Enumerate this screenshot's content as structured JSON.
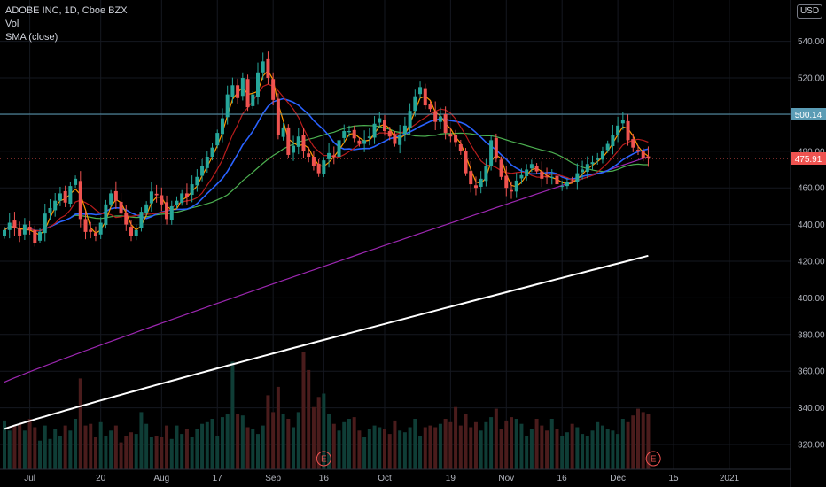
{
  "header": {
    "symbol": "ADOBE INC, 1D, Cboe BZX",
    "vol_label": "Vol",
    "sma_label": "SMA (close)",
    "currency": "USD"
  },
  "price_tags": {
    "resistance": "500.14",
    "last": "475.91"
  },
  "colors": {
    "background": "#000000",
    "up": "#26a69a",
    "down": "#ef5350",
    "sma_orange": "#ff9800",
    "sma_darkred": "#b71c1c",
    "sma_blue": "#2962ff",
    "sma_green": "#4caf50",
    "sma_purple": "#9c27b0",
    "sma_white": "#ffffff",
    "resistance_line": "#5b9cb5"
  },
  "chart_data": {
    "type": "candlestick",
    "ylim": [
      310,
      562
    ],
    "y_ticks": [
      320,
      340,
      360,
      380,
      400,
      420,
      440,
      460,
      480,
      500,
      520,
      540
    ],
    "x_labels": [
      "Jul",
      "20",
      "Aug",
      "17",
      "Sep",
      "16",
      "Oct",
      "19",
      "Nov",
      "16",
      "Dec",
      "15",
      "2021"
    ],
    "x_label_index": [
      5,
      19,
      31,
      42,
      53,
      63,
      75,
      88,
      99,
      110,
      121,
      132,
      143
    ],
    "earnings_index": [
      63,
      128
    ],
    "earnings_label": "E",
    "resistance_level": 500.14,
    "last_price": 475.91,
    "closes": [
      437,
      441,
      438,
      434,
      440,
      437,
      430,
      436,
      446,
      449,
      453,
      457,
      452,
      461,
      465,
      443,
      436,
      436,
      434,
      441,
      451,
      457,
      453,
      446,
      440,
      434,
      437,
      447,
      451,
      458,
      456,
      451,
      443,
      450,
      453,
      457,
      455,
      462,
      466,
      472,
      477,
      482,
      490,
      498,
      511,
      516,
      509,
      520,
      504,
      511,
      523,
      529,
      520,
      508,
      489,
      493,
      478,
      483,
      488,
      480,
      477,
      472,
      468,
      475,
      479,
      477,
      486,
      491,
      491,
      487,
      484,
      486,
      488,
      495,
      498,
      491,
      488,
      484,
      489,
      494,
      502,
      510,
      515,
      505,
      503,
      496,
      499,
      490,
      488,
      485,
      480,
      468,
      462,
      460,
      465,
      472,
      486,
      476,
      466,
      460,
      458,
      464,
      467,
      470,
      473,
      469,
      465,
      466,
      466,
      462,
      461,
      463,
      464,
      468,
      470,
      473,
      474,
      476,
      480,
      484,
      489,
      494,
      497,
      486,
      482,
      480,
      476,
      476
    ],
    "volumes_m": [
      2.9,
      2.3,
      2.6,
      2.7,
      2.3,
      3.0,
      2.5,
      1.7,
      2.6,
      1.8,
      2.4,
      2.0,
      2.6,
      2.3,
      3.0,
      5.4,
      2.6,
      2.7,
      1.9,
      2.8,
      2.0,
      2.3,
      2.6,
      1.6,
      2.0,
      2.2,
      2.1,
      3.4,
      2.7,
      1.9,
      2.0,
      1.9,
      2.6,
      1.8,
      2.6,
      2.1,
      2.4,
      1.9,
      2.4,
      2.7,
      2.8,
      3.0,
      2.0,
      3.1,
      3.3,
      6.4,
      3.3,
      3.2,
      2.5,
      2.4,
      2.1,
      2.6,
      4.4,
      3.4,
      4.9,
      3.3,
      3.0,
      2.5,
      3.4,
      7.0,
      5.9,
      3.7,
      4.3,
      4.5,
      3.3,
      2.7,
      2.3,
      2.8,
      3.0,
      3.1,
      2.3,
      1.9,
      2.4,
      2.6,
      2.5,
      2.4,
      2.1,
      2.9,
      2.3,
      2.2,
      2.5,
      3.0,
      2.0,
      2.5,
      2.6,
      2.5,
      2.7,
      3.0,
      2.8,
      3.7,
      2.6,
      3.3,
      2.5,
      2.8,
      2.3,
      2.8,
      3.1,
      3.6,
      2.4,
      2.9,
      3.1,
      3.0,
      2.7,
      2.0,
      2.4,
      3.0,
      2.6,
      2.3,
      3.0,
      2.4,
      2.0,
      2.2,
      2.7,
      2.5,
      2.1,
      2.0,
      2.3,
      2.8,
      2.6,
      2.4,
      2.3,
      2.1,
      3.0,
      2.8,
      3.2,
      3.6,
      3.4,
      3.3
    ],
    "sma_white_endpoints": [
      328.5,
      423
    ],
    "sma_purple_endpoints": [
      354,
      477
    ]
  }
}
